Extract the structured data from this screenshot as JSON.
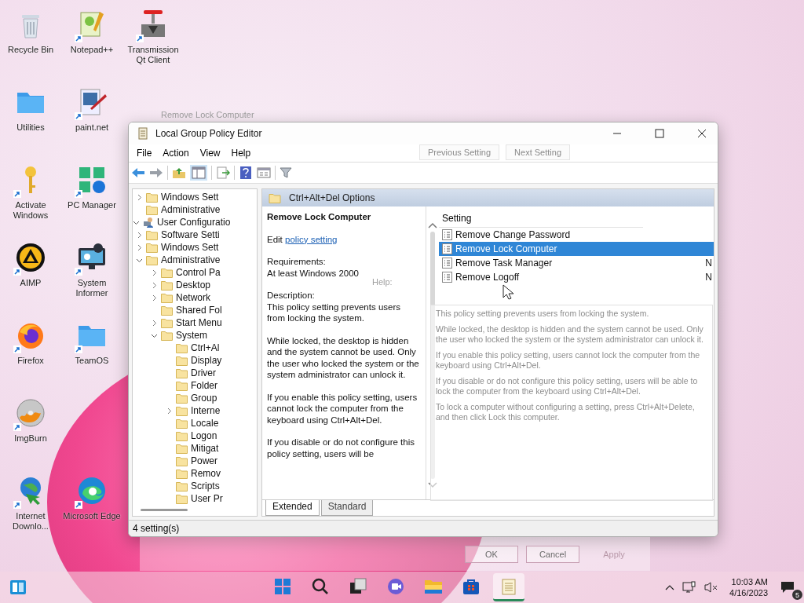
{
  "desktop": {
    "columns": [
      [
        {
          "label": "Recycle Bin",
          "kind": "bin",
          "shortcut": false
        },
        {
          "label": "Utilities",
          "kind": "folder",
          "shortcut": false
        },
        {
          "label": "Activate Windows",
          "kind": "key",
          "shortcut": true
        },
        {
          "label": "AIMP",
          "kind": "triangle",
          "shortcut": true
        },
        {
          "label": "Firefox",
          "kind": "fox",
          "shortcut": true
        },
        {
          "label": "ImgBurn",
          "kind": "disc",
          "shortcut": true
        },
        {
          "label": "Internet Downlo...",
          "kind": "globe",
          "shortcut": true
        }
      ],
      [
        {
          "label": "Notepad++",
          "kind": "notepad",
          "shortcut": true
        },
        {
          "label": "paint.net",
          "kind": "paint",
          "shortcut": true
        },
        {
          "label": "PC Manager",
          "kind": "leaf",
          "shortcut": true
        },
        {
          "label": "System Informer",
          "kind": "monitor",
          "shortcut": true
        },
        {
          "label": "TeamOS",
          "kind": "folder",
          "shortcut": true
        },
        {
          "label": "Microsoft Edge",
          "kind": "wave",
          "shortcut": true
        }
      ],
      [
        {
          "label": "Transmission Qt Client",
          "kind": "plunger",
          "shortcut": true
        }
      ]
    ]
  },
  "window": {
    "title": "Local Group Policy Editor",
    "menu": [
      "File",
      "Action",
      "View",
      "Help"
    ],
    "tree": [
      {
        "children": [
          {
            "label": "Windows Sett",
            "kind": "folder",
            "expanded": false
          },
          {
            "label": "Administrative",
            "kind": "folder"
          }
        ]
      },
      {
        "label": "User Configuratio",
        "kind": "user",
        "expanded": true,
        "children": [
          {
            "label": "Software Setti",
            "kind": "folder",
            "expanded": false
          },
          {
            "label": "Windows Sett",
            "kind": "folder",
            "expanded": false
          },
          {
            "label": "Administrative",
            "kind": "folder",
            "expanded": true,
            "children": [
              {
                "label": "Control Pa",
                "kind": "folder",
                "expanded": false
              },
              {
                "label": "Desktop",
                "kind": "folder",
                "expanded": false
              },
              {
                "label": "Network",
                "kind": "folder",
                "expanded": false
              },
              {
                "label": "Shared Fol",
                "kind": "folder"
              },
              {
                "label": "Start Menu",
                "kind": "folder",
                "expanded": false
              },
              {
                "label": "System",
                "kind": "folder",
                "expanded": true,
                "children": [
                  {
                    "label": "Ctrl+Al",
                    "kind": "folder"
                  },
                  {
                    "label": "Display",
                    "kind": "folder"
                  },
                  {
                    "label": "Driver",
                    "kind": "folder"
                  },
                  {
                    "label": "Folder",
                    "kind": "folder"
                  },
                  {
                    "label": "Group",
                    "kind": "folder"
                  },
                  {
                    "label": "Interne",
                    "kind": "folder",
                    "expanded": false
                  },
                  {
                    "label": "Locale",
                    "kind": "folder"
                  },
                  {
                    "label": "Logon",
                    "kind": "folder"
                  },
                  {
                    "label": "Mitigat",
                    "kind": "folder"
                  },
                  {
                    "label": "Power",
                    "kind": "folder"
                  },
                  {
                    "label": "Remov",
                    "kind": "folder"
                  },
                  {
                    "label": "Scripts",
                    "kind": "folder"
                  },
                  {
                    "label": "User Pr",
                    "kind": "folder"
                  }
                ]
              }
            ]
          }
        ]
      }
    ],
    "details": {
      "header": "Ctrl+Alt+Del Options",
      "title": "Remove Lock Computer",
      "edit_prefix": "Edit",
      "edit_link": "policy setting",
      "requirements_label": "Requirements:",
      "requirements": "At least Windows 2000",
      "description_label": "Description:",
      "description": [
        "This policy setting prevents users from locking the system.",
        "While locked, the desktop is hidden and the system cannot be used. Only the user who locked the system or the system administrator can unlock it.",
        "If you enable this policy setting, users cannot lock the computer from the keyboard using Ctrl+Alt+Del.",
        "If you disable or do not configure this policy setting, users will be"
      ]
    },
    "list": {
      "column": "Setting",
      "rows": [
        {
          "name": "Remove Change Password",
          "selected": false
        },
        {
          "name": "Remove Lock Computer",
          "selected": true
        },
        {
          "name": "Remove Task Manager",
          "selected": false,
          "column_2": "N"
        },
        {
          "name": "Remove Logoff",
          "selected": false,
          "column_2": "N"
        }
      ]
    },
    "view_tabs": [
      {
        "label": "Extended",
        "selected": true
      },
      {
        "label": "Standard",
        "selected": false
      }
    ],
    "status_bar": "4 setting(s)"
  },
  "ghost_dialog": {
    "title": "Remove Lock Computer",
    "nav_buttons": [
      "Previous Setting",
      "Next Setting"
    ],
    "help_label": "Help:",
    "help": [
      "This policy setting prevents users from locking the system.",
      "While locked, the desktop is hidden and the system cannot be used. Only the user who locked the system or the system administrator can unlock it.",
      "If you enable this policy setting, users cannot lock the computer from the keyboard using Ctrl+Alt+Del.",
      "If you disable or do not configure this policy setting, users will be able to lock the computer from the keyboard using Ctrl+Alt+Del.",
      "To lock a computer without configuring a setting, press Ctrl+Alt+Delete, and then click Lock this computer."
    ],
    "buttons": [
      {
        "label": "OK",
        "disabled": false
      },
      {
        "label": "Cancel",
        "disabled": false
      },
      {
        "label": "Apply",
        "disabled": true
      }
    ]
  },
  "taskbar": {
    "apps": [
      {
        "kind": "start",
        "active": false
      },
      {
        "kind": "search",
        "active": false
      },
      {
        "kind": "taskview",
        "active": false
      },
      {
        "kind": "video",
        "active": false
      },
      {
        "kind": "explorer",
        "active": false
      },
      {
        "kind": "store",
        "active": false
      },
      {
        "kind": "notepad",
        "active": true
      }
    ],
    "time": "10:03 AM",
    "date": "4/16/2023",
    "notification_count": "5"
  }
}
